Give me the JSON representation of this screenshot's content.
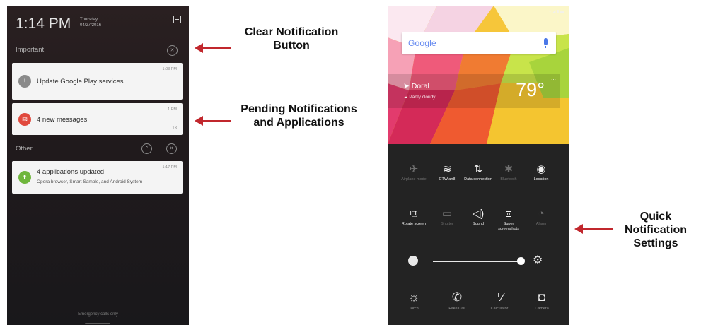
{
  "notification_screen": {
    "time": "1:14 PM",
    "date_line1": "Thursday",
    "date_line2": "04/27/2016",
    "sections": {
      "important": "Important",
      "other": "Other"
    },
    "notifications": [
      {
        "title": "Update Google Play services",
        "time": "1:03 PM",
        "icon": "warning-icon",
        "icon_bg": "#8a8a8a"
      },
      {
        "title": "4 new messages",
        "time": "1 PM",
        "count": "13",
        "icon": "message-icon",
        "icon_bg": "#e0493d"
      },
      {
        "title": "4 applications updated",
        "subtitle": "Opera browser, Smart Sample, and Android System",
        "time": "1:17 PM",
        "icon": "app-update-icon",
        "icon_bg": "#6fb63c"
      }
    ],
    "footer": "Emergency calls only"
  },
  "annotations": {
    "clear": "Clear Notification Button",
    "pending": "Pending Notifications and Applications",
    "quick": "Quick Notification Settings",
    "arrow_color": "#c1272d"
  },
  "home_screen": {
    "search_logo": "Google",
    "weather": {
      "location": "Doral",
      "condition": "Partly cloudy",
      "temperature": "79°"
    },
    "quick_settings": [
      {
        "label": "Airplane mode",
        "icon": "airplane-icon",
        "on": false
      },
      {
        "label": "CTWlan8",
        "icon": "wifi-icon",
        "on": true
      },
      {
        "label": "Data connection",
        "icon": "data-connection-icon",
        "on": true
      },
      {
        "label": "Bluetooth",
        "icon": "bluetooth-icon",
        "on": false
      },
      {
        "label": "Location",
        "icon": "location-icon",
        "on": true
      },
      {
        "label": "Rotate screen",
        "icon": "rotate-screen-icon",
        "on": true
      },
      {
        "label": "Shutter",
        "icon": "shutter-icon",
        "on": false
      },
      {
        "label": "Sound",
        "icon": "sound-icon",
        "on": true
      },
      {
        "label": "Super screenshots",
        "icon": "screenshot-icon",
        "on": true
      },
      {
        "label": "Alarm",
        "icon": "alarm-icon",
        "on": false
      }
    ],
    "bottom_shortcuts": [
      {
        "label": "Torch",
        "icon": "torch-icon"
      },
      {
        "label": "Fake Call",
        "icon": "fake-call-icon"
      },
      {
        "label": "Calculator",
        "icon": "calculator-icon"
      },
      {
        "label": "Camera",
        "icon": "camera-icon"
      }
    ]
  }
}
